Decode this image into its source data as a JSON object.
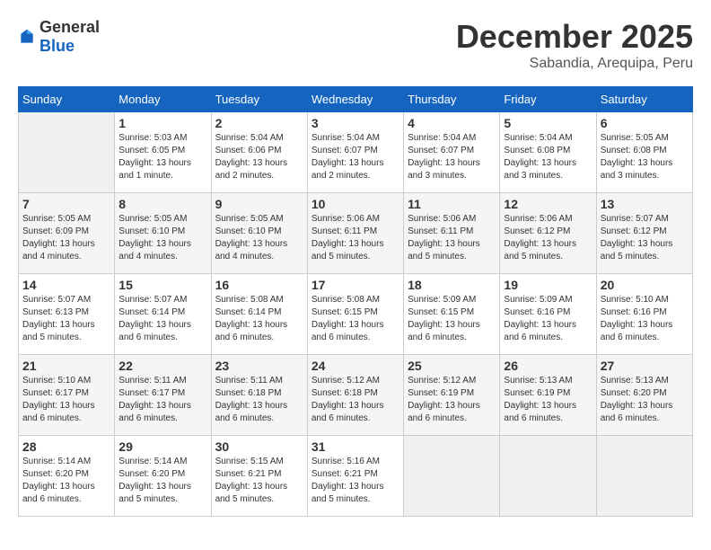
{
  "logo": {
    "general": "General",
    "blue": "Blue"
  },
  "title": "December 2025",
  "subtitle": "Sabandia, Arequipa, Peru",
  "days_of_week": [
    "Sunday",
    "Monday",
    "Tuesday",
    "Wednesday",
    "Thursday",
    "Friday",
    "Saturday"
  ],
  "weeks": [
    [
      {
        "day": "",
        "sunrise": "",
        "sunset": "",
        "daylight": ""
      },
      {
        "day": "1",
        "sunrise": "Sunrise: 5:03 AM",
        "sunset": "Sunset: 6:05 PM",
        "daylight": "Daylight: 13 hours and 1 minute."
      },
      {
        "day": "2",
        "sunrise": "Sunrise: 5:04 AM",
        "sunset": "Sunset: 6:06 PM",
        "daylight": "Daylight: 13 hours and 2 minutes."
      },
      {
        "day": "3",
        "sunrise": "Sunrise: 5:04 AM",
        "sunset": "Sunset: 6:07 PM",
        "daylight": "Daylight: 13 hours and 2 minutes."
      },
      {
        "day": "4",
        "sunrise": "Sunrise: 5:04 AM",
        "sunset": "Sunset: 6:07 PM",
        "daylight": "Daylight: 13 hours and 3 minutes."
      },
      {
        "day": "5",
        "sunrise": "Sunrise: 5:04 AM",
        "sunset": "Sunset: 6:08 PM",
        "daylight": "Daylight: 13 hours and 3 minutes."
      },
      {
        "day": "6",
        "sunrise": "Sunrise: 5:05 AM",
        "sunset": "Sunset: 6:08 PM",
        "daylight": "Daylight: 13 hours and 3 minutes."
      }
    ],
    [
      {
        "day": "7",
        "sunrise": "Sunrise: 5:05 AM",
        "sunset": "Sunset: 6:09 PM",
        "daylight": "Daylight: 13 hours and 4 minutes."
      },
      {
        "day": "8",
        "sunrise": "Sunrise: 5:05 AM",
        "sunset": "Sunset: 6:10 PM",
        "daylight": "Daylight: 13 hours and 4 minutes."
      },
      {
        "day": "9",
        "sunrise": "Sunrise: 5:05 AM",
        "sunset": "Sunset: 6:10 PM",
        "daylight": "Daylight: 13 hours and 4 minutes."
      },
      {
        "day": "10",
        "sunrise": "Sunrise: 5:06 AM",
        "sunset": "Sunset: 6:11 PM",
        "daylight": "Daylight: 13 hours and 5 minutes."
      },
      {
        "day": "11",
        "sunrise": "Sunrise: 5:06 AM",
        "sunset": "Sunset: 6:11 PM",
        "daylight": "Daylight: 13 hours and 5 minutes."
      },
      {
        "day": "12",
        "sunrise": "Sunrise: 5:06 AM",
        "sunset": "Sunset: 6:12 PM",
        "daylight": "Daylight: 13 hours and 5 minutes."
      },
      {
        "day": "13",
        "sunrise": "Sunrise: 5:07 AM",
        "sunset": "Sunset: 6:12 PM",
        "daylight": "Daylight: 13 hours and 5 minutes."
      }
    ],
    [
      {
        "day": "14",
        "sunrise": "Sunrise: 5:07 AM",
        "sunset": "Sunset: 6:13 PM",
        "daylight": "Daylight: 13 hours and 5 minutes."
      },
      {
        "day": "15",
        "sunrise": "Sunrise: 5:07 AM",
        "sunset": "Sunset: 6:14 PM",
        "daylight": "Daylight: 13 hours and 6 minutes."
      },
      {
        "day": "16",
        "sunrise": "Sunrise: 5:08 AM",
        "sunset": "Sunset: 6:14 PM",
        "daylight": "Daylight: 13 hours and 6 minutes."
      },
      {
        "day": "17",
        "sunrise": "Sunrise: 5:08 AM",
        "sunset": "Sunset: 6:15 PM",
        "daylight": "Daylight: 13 hours and 6 minutes."
      },
      {
        "day": "18",
        "sunrise": "Sunrise: 5:09 AM",
        "sunset": "Sunset: 6:15 PM",
        "daylight": "Daylight: 13 hours and 6 minutes."
      },
      {
        "day": "19",
        "sunrise": "Sunrise: 5:09 AM",
        "sunset": "Sunset: 6:16 PM",
        "daylight": "Daylight: 13 hours and 6 minutes."
      },
      {
        "day": "20",
        "sunrise": "Sunrise: 5:10 AM",
        "sunset": "Sunset: 6:16 PM",
        "daylight": "Daylight: 13 hours and 6 minutes."
      }
    ],
    [
      {
        "day": "21",
        "sunrise": "Sunrise: 5:10 AM",
        "sunset": "Sunset: 6:17 PM",
        "daylight": "Daylight: 13 hours and 6 minutes."
      },
      {
        "day": "22",
        "sunrise": "Sunrise: 5:11 AM",
        "sunset": "Sunset: 6:17 PM",
        "daylight": "Daylight: 13 hours and 6 minutes."
      },
      {
        "day": "23",
        "sunrise": "Sunrise: 5:11 AM",
        "sunset": "Sunset: 6:18 PM",
        "daylight": "Daylight: 13 hours and 6 minutes."
      },
      {
        "day": "24",
        "sunrise": "Sunrise: 5:12 AM",
        "sunset": "Sunset: 6:18 PM",
        "daylight": "Daylight: 13 hours and 6 minutes."
      },
      {
        "day": "25",
        "sunrise": "Sunrise: 5:12 AM",
        "sunset": "Sunset: 6:19 PM",
        "daylight": "Daylight: 13 hours and 6 minutes."
      },
      {
        "day": "26",
        "sunrise": "Sunrise: 5:13 AM",
        "sunset": "Sunset: 6:19 PM",
        "daylight": "Daylight: 13 hours and 6 minutes."
      },
      {
        "day": "27",
        "sunrise": "Sunrise: 5:13 AM",
        "sunset": "Sunset: 6:20 PM",
        "daylight": "Daylight: 13 hours and 6 minutes."
      }
    ],
    [
      {
        "day": "28",
        "sunrise": "Sunrise: 5:14 AM",
        "sunset": "Sunset: 6:20 PM",
        "daylight": "Daylight: 13 hours and 6 minutes."
      },
      {
        "day": "29",
        "sunrise": "Sunrise: 5:14 AM",
        "sunset": "Sunset: 6:20 PM",
        "daylight": "Daylight: 13 hours and 5 minutes."
      },
      {
        "day": "30",
        "sunrise": "Sunrise: 5:15 AM",
        "sunset": "Sunset: 6:21 PM",
        "daylight": "Daylight: 13 hours and 5 minutes."
      },
      {
        "day": "31",
        "sunrise": "Sunrise: 5:16 AM",
        "sunset": "Sunset: 6:21 PM",
        "daylight": "Daylight: 13 hours and 5 minutes."
      },
      {
        "day": "",
        "sunrise": "",
        "sunset": "",
        "daylight": ""
      },
      {
        "day": "",
        "sunrise": "",
        "sunset": "",
        "daylight": ""
      },
      {
        "day": "",
        "sunrise": "",
        "sunset": "",
        "daylight": ""
      }
    ]
  ]
}
